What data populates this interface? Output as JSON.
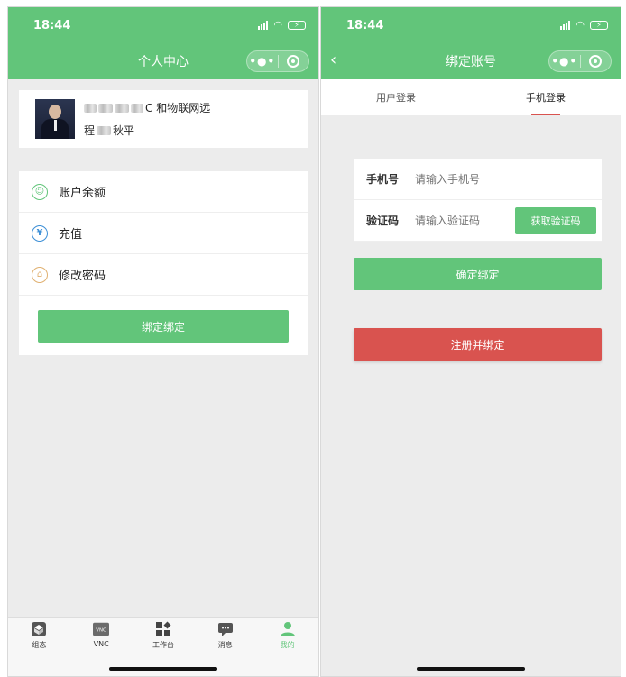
{
  "left": {
    "status": {
      "time": "18:44"
    },
    "nav": {
      "title": "个人中心"
    },
    "profile": {
      "line1_suffix": "C 和物联网远",
      "line2_prefix": "程",
      "line2_suffix": "秋平"
    },
    "menu": [
      {
        "label": "账户余额",
        "icon": "user-circle-icon"
      },
      {
        "label": "充值",
        "icon": "yen-icon"
      },
      {
        "label": "修改密码",
        "icon": "lock-icon"
      }
    ],
    "bind_button": "绑定绑定",
    "tabbar": [
      {
        "label": "组态",
        "icon": "cube-icon"
      },
      {
        "label": "VNC",
        "icon": "vnc-icon",
        "badge": "VNC"
      },
      {
        "label": "工作台",
        "icon": "grid-icon"
      },
      {
        "label": "消息",
        "icon": "chat-icon"
      },
      {
        "label": "我的",
        "icon": "person-icon",
        "active": true
      }
    ]
  },
  "right": {
    "status": {
      "time": "18:44"
    },
    "nav": {
      "title": "绑定账号"
    },
    "tabs": [
      {
        "label": "用户登录"
      },
      {
        "label": "手机登录",
        "active": true
      }
    ],
    "form": {
      "phone_label": "手机号",
      "phone_placeholder": "请输入手机号",
      "code_label": "验证码",
      "code_placeholder": "请输入验证码",
      "get_code": "获取验证码"
    },
    "confirm_button": "确定绑定",
    "register_button": "注册并绑定"
  },
  "colors": {
    "accent": "#62c57a",
    "danger": "#d9534f",
    "background": "#ececec"
  }
}
